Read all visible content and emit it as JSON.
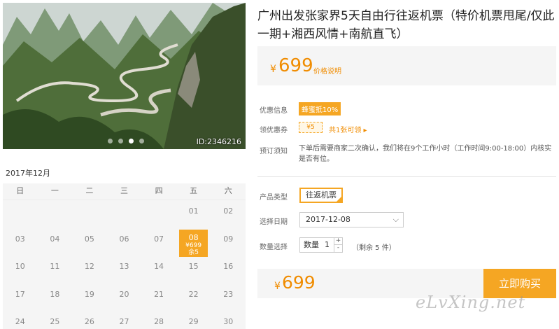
{
  "product": {
    "title": "广州出发张家界5天自由行往返机票（特价机票甩尾/仅此一期+湘西风情+南航直飞）",
    "price_currency": "¥",
    "price": "699",
    "price_note": "价格说明"
  },
  "photo": {
    "id_label": "ID:2346216",
    "carousel_count": 4,
    "active_index": 2
  },
  "info": {
    "discount_label": "优惠信息",
    "discount_badge": "蜂蜜抵10%",
    "coupon_label": "领优惠券",
    "coupon_value": "¥5",
    "coupon_link": "共1张可领 ▸",
    "notice_label": "预订须知",
    "notice_text": "下单后需要商家二次确认，我们将在9个工作小时（工作时间9:00-18:00）内核实是否有位。"
  },
  "options": {
    "type_label": "产品类型",
    "type_value": "往返机票",
    "date_label": "选择日期",
    "date_value": "2017-12-08",
    "qty_label": "数量选择",
    "qty_prefix": "数量",
    "qty_value": "1",
    "stock_note": "（剩余 5 件）"
  },
  "bottom": {
    "currency": "¥",
    "price": "699",
    "buy_label": "立即购买"
  },
  "calendar": {
    "month_label": "2017年12月",
    "weekdays": [
      "日",
      "一",
      "二",
      "三",
      "四",
      "五",
      "六"
    ],
    "selected_day": {
      "num": "08",
      "price": "¥699",
      "remain": "余5"
    }
  },
  "watermark": "eLvXing.net",
  "colors": {
    "accent": "#f5a623",
    "price": "#f08c00"
  }
}
